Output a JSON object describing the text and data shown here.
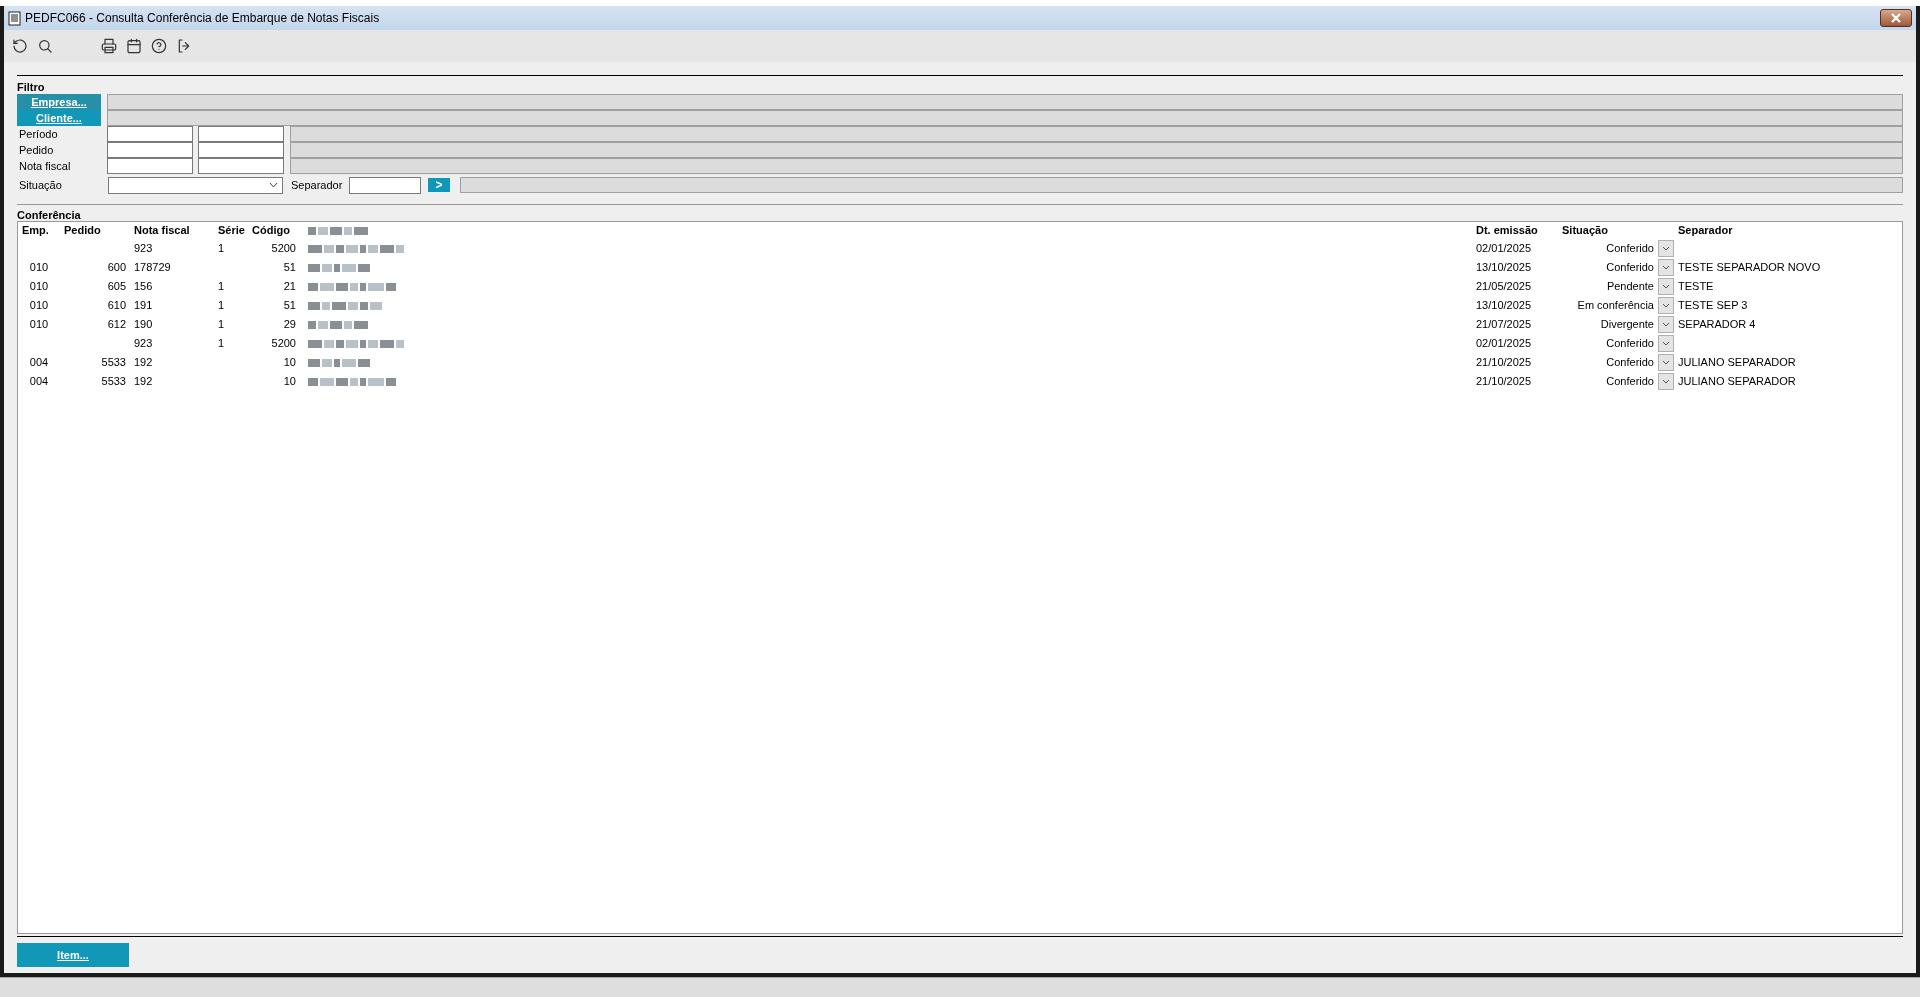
{
  "window": {
    "title": "PEDFC066 - Consulta Conferência de Embarque de Notas Fiscais"
  },
  "filter": {
    "title": "Filtro",
    "company_button": "Empresa...",
    "client_button": "Cliente...",
    "period_label": "Período",
    "order_label": "Pedido",
    "invoice_label": "Nota fiscal",
    "status_label": "Situação",
    "separator_label": "Separador",
    "go_button": ">"
  },
  "table": {
    "title": "Conferência",
    "columns": [
      "Emp.",
      "Pedido",
      "Nota fiscal",
      "Série",
      "Código",
      "Dt. emissão",
      "Situação",
      "Separador"
    ],
    "rows": [
      {
        "emp": "",
        "pedido": "",
        "nota": "923",
        "serie": "1",
        "codigo": "5200",
        "date": "02/01/2025",
        "status": "Conferido",
        "separator": ""
      },
      {
        "emp": "010",
        "pedido": "600",
        "nota": "178729",
        "serie": "",
        "codigo": "51",
        "date": "13/10/2025",
        "status": "Conferido",
        "separator": "TESTE SEPARADOR NOVO"
      },
      {
        "emp": "010",
        "pedido": "605",
        "nota": "156",
        "serie": "1",
        "codigo": "21",
        "date": "21/05/2025",
        "status": "Pendente",
        "separator": "TESTE"
      },
      {
        "emp": "010",
        "pedido": "610",
        "nota": "191",
        "serie": "1",
        "codigo": "51",
        "date": "13/10/2025",
        "status": "Em conferência",
        "separator": "TESTE SEP 3"
      },
      {
        "emp": "010",
        "pedido": "612",
        "nota": "190",
        "serie": "1",
        "codigo": "29",
        "date": "21/07/2025",
        "status": "Divergente",
        "separator": "SEPARADOR 4"
      },
      {
        "emp": "",
        "pedido": "",
        "nota": "923",
        "serie": "1",
        "codigo": "5200",
        "date": "02/01/2025",
        "status": "Conferido",
        "separator": ""
      },
      {
        "emp": "004",
        "pedido": "5533",
        "nota": "192",
        "serie": "",
        "codigo": "10",
        "date": "21/10/2025",
        "status": "Conferido",
        "separator": "JULIANO SEPARADOR"
      },
      {
        "emp": "004",
        "pedido": "5533",
        "nota": "192",
        "serie": "",
        "codigo": "10",
        "date": "21/10/2025",
        "status": "Conferido",
        "separator": "JULIANO SEPARADOR"
      }
    ]
  },
  "item_button": "Item..."
}
